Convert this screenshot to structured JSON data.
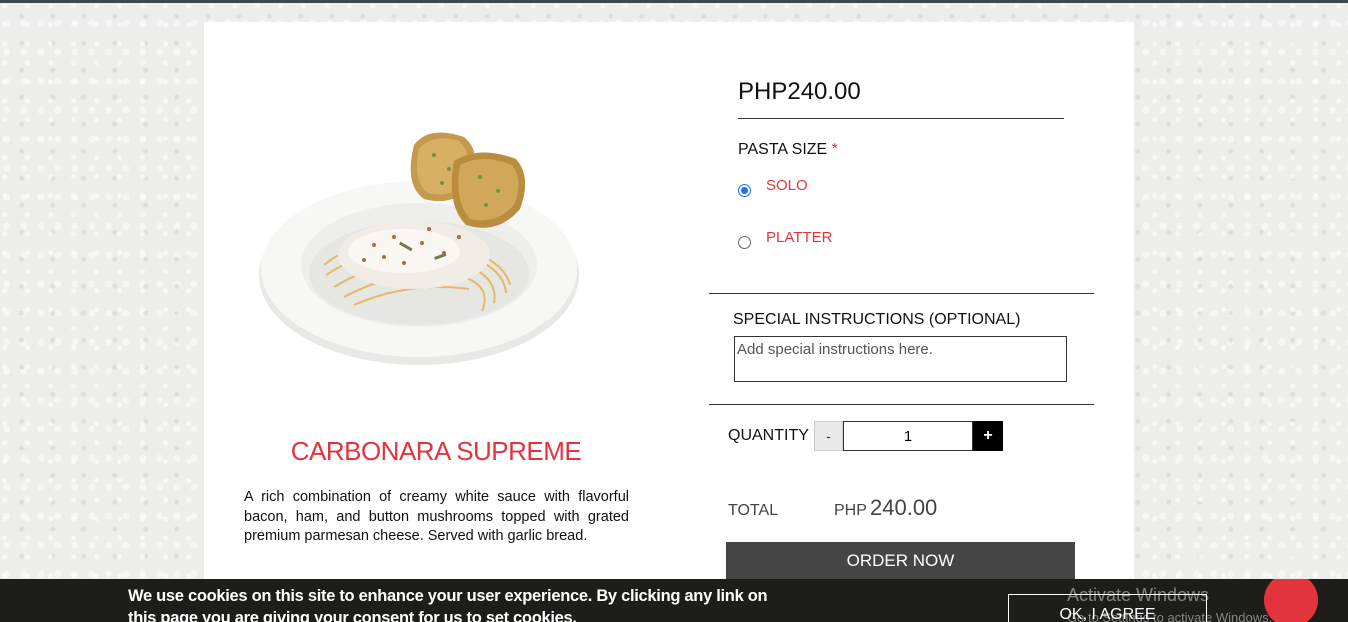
{
  "product": {
    "name": "CARBONARA SUPREME",
    "description": "A rich combination of creamy white sauce with flavorful bacon, ham, and button mushrooms topped with grated premium parmesan cheese. Served with garlic bread.",
    "image": "carbonara-plate-with-garlic-bread",
    "price": "PHP240.00"
  },
  "size": {
    "label": "PASTA SIZE",
    "required_mark": "*",
    "options": [
      {
        "label": "SOLO",
        "selected": true
      },
      {
        "label": "PLATTER",
        "selected": false
      }
    ]
  },
  "special_instructions": {
    "label": "SPECIAL INSTRUCTIONS (OPTIONAL)",
    "placeholder": "Add special instructions here.",
    "value": ""
  },
  "quantity": {
    "label": "QUANTITY",
    "minus": "-",
    "value": "1",
    "plus": "+"
  },
  "total": {
    "label": "TOTAL",
    "currency": "PHP",
    "amount": "240.00"
  },
  "order_button": "ORDER NOW",
  "cookie_banner": {
    "text": "We use cookies on this site to enhance your user experience. By clicking any link on this page you are giving your consent for us to set cookies.",
    "agree_button": "OK, I AGREE"
  },
  "watermark": {
    "line1": "Activate Windows",
    "line2": "Go to Settings to activate Windows."
  },
  "colors": {
    "accent": "#e3343e",
    "button_dark": "#454545",
    "banner_bg": "#1d1d1b"
  }
}
